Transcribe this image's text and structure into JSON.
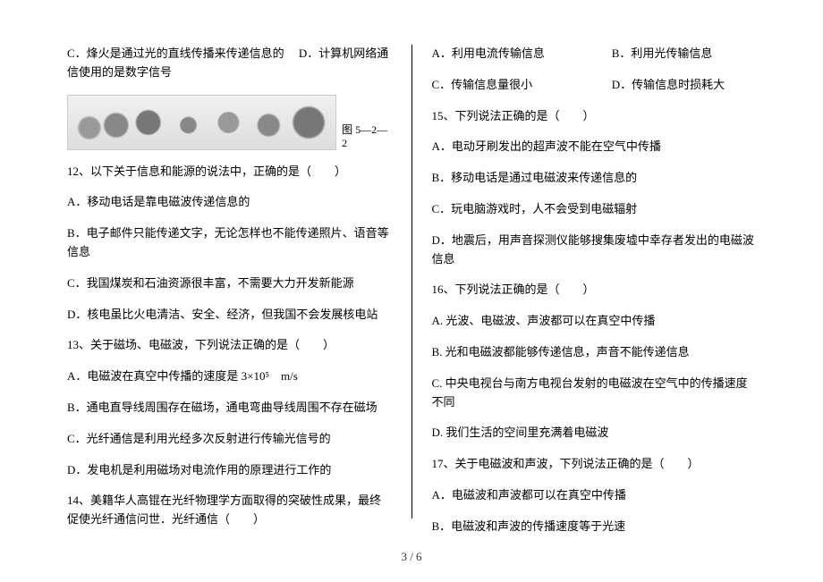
{
  "left": {
    "q11_c": "C．烽火是通过光的直线传播来传递信息的",
    "q11_d": "D．计算机网络通信使用的是数字信号",
    "fig_caption": "图 5—2—2",
    "q12_stem": "12、以下关于信息和能源的说法中，正确的是（　　）",
    "q12_a": "A．移动电话是靠电磁波传递信息的",
    "q12_b": "B．电子邮件只能传递文字，无论怎样也不能传递照片、语音等信息",
    "q12_c": "C．我国煤炭和石油资源很丰富，不需要大力开发新能源",
    "q12_d": "D．核电虽比火电清洁、安全、经济，但我国不会发展核电站",
    "q13_stem": "13、关于磁场、电磁波，下列说法正确的是（　　）",
    "q13_a": "A．电磁波在真空中传播的速度是 3×10⁵　m/s",
    "q13_b": "B．通电直导线周围存在磁场，通电弯曲导线周围不存在磁场",
    "q13_c": "C．光纤通信是利用光经多次反射进行传输光信号的",
    "q13_d": "D．发电机是利用磁场对电流作用的原理进行工作的",
    "q14_stem": "14、美籍华人高锟在光纤物理学方面取得的突破性成果，最终促使光纤通信问世．光纤通信（　　）"
  },
  "right": {
    "q14_a": "A．利用电流传输信息",
    "q14_b": "B．利用光传输信息",
    "q14_c": "C．传输信息量很小",
    "q14_d": "D．传输信息时损耗大",
    "q15_stem": "15、下列说法正确的是（　　）",
    "q15_a": "A．电动牙刷发出的超声波不能在空气中传播",
    "q15_b": "B．移动电话是通过电磁波来传递信息的",
    "q15_c": "C．玩电脑游戏时，人不会受到电磁辐射",
    "q15_d": "D．地震后，用声音探测仪能够搜集废墟中幸存者发出的电磁波信息",
    "q16_stem": "16、下列说法正确的是（　　）",
    "q16_a": "A. 光波、电磁波、声波都可以在真空中传播",
    "q16_b": "B. 光和电磁波都能够传递信息，声音不能传递信息",
    "q16_c": "C. 中央电视台与南方电视台发射的电磁波在空气中的传播速度不同",
    "q16_d": "D. 我们生活的空间里充满着电磁波",
    "q17_stem": "17、关于电磁波和声波，下列说法正确的是（　　）",
    "q17_a": "A．电磁波和声波都可以在真空中传播",
    "q17_b": "B．电磁波和声波的传播速度等于光速"
  },
  "footer": "3 / 6"
}
